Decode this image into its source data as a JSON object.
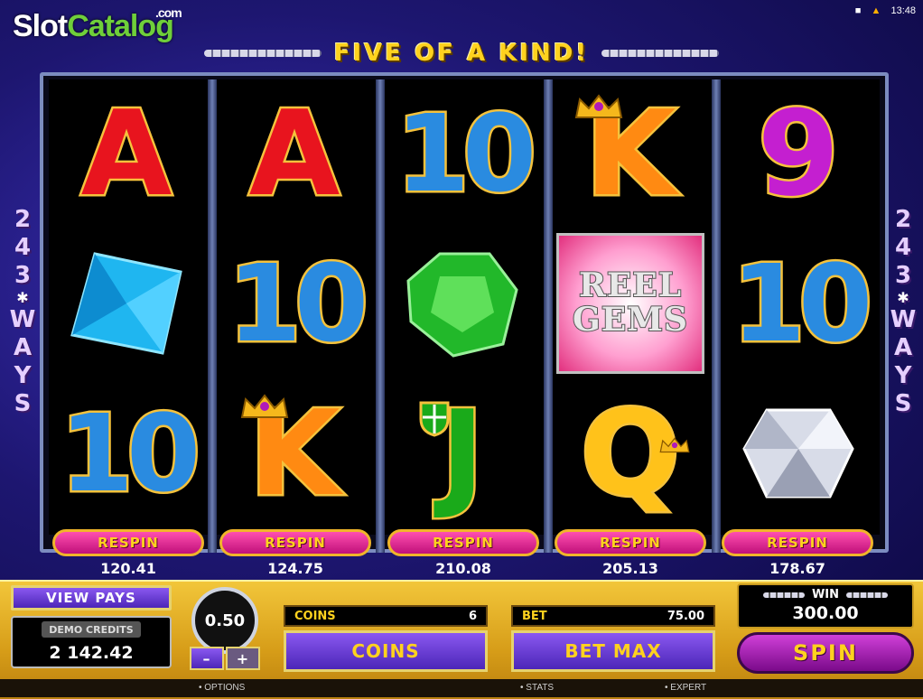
{
  "logo": {
    "part1": "Slot",
    "part2": "Catalog",
    "suffix": ".com"
  },
  "status": {
    "time": "13:48"
  },
  "banner": {
    "text": "FIVE OF A KIND!"
  },
  "ways": {
    "left": [
      "2",
      "4",
      "3",
      "✱",
      "W",
      "A",
      "Y",
      "S"
    ],
    "right": [
      "2",
      "4",
      "3",
      "✱",
      "W",
      "A",
      "Y",
      "S"
    ]
  },
  "reels": [
    {
      "symbols": [
        "A",
        "blue-gem",
        "10"
      ],
      "respin_label": "RESPIN",
      "respin_value": "120.41"
    },
    {
      "symbols": [
        "A",
        "10",
        "K"
      ],
      "respin_label": "RESPIN",
      "respin_value": "124.75"
    },
    {
      "symbols": [
        "10",
        "green-gem",
        "J"
      ],
      "respin_label": "RESPIN",
      "respin_value": "210.08"
    },
    {
      "symbols": [
        "K",
        "REEL GEMS",
        "Q"
      ],
      "respin_label": "RESPIN",
      "respin_value": "205.13"
    },
    {
      "symbols": [
        "9",
        "10",
        "white-diamond"
      ],
      "respin_label": "RESPIN",
      "respin_value": "178.67"
    }
  ],
  "reel_gems_logo": {
    "line1": "REEL",
    "line2": "GEMS"
  },
  "controls": {
    "view_pays": "VIEW PAYS",
    "demo_credits_label": "DEMO CREDITS",
    "demo_credits_value": "2 142.42",
    "coin_value": "0.50",
    "minus": "–",
    "plus": "+",
    "coins_label": "COINS",
    "coins_value": "6",
    "coins_button": "COINS",
    "bet_label": "BET",
    "bet_value": "75.00",
    "bet_max_button": "BET MAX",
    "win_label": "WIN",
    "win_value": "300.00",
    "spin_button": "SPIN"
  },
  "bottom_menu": {
    "options": "OPTIONS",
    "stats": "STATS",
    "expert": "EXPERT"
  },
  "colors": {
    "background": "#1d1670",
    "gold": "#ffd21e",
    "respin": "#e2309a",
    "panel": "#e0a822"
  }
}
